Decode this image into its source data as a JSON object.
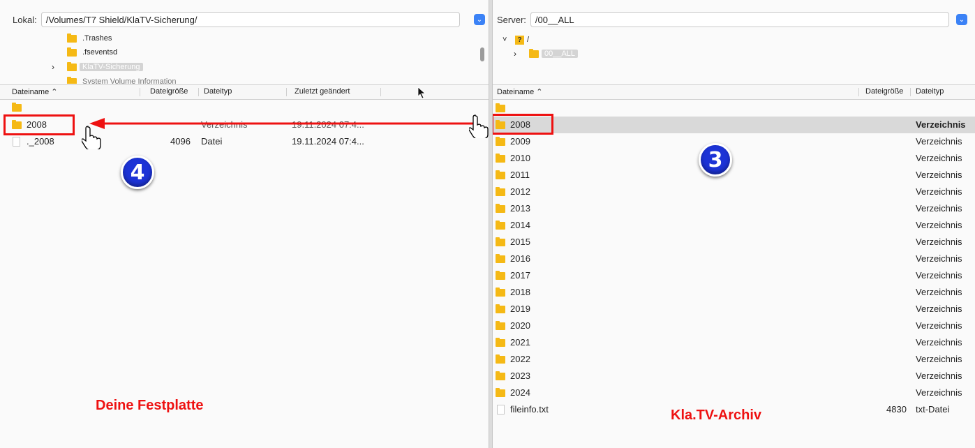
{
  "local": {
    "label": "Lokal:",
    "path": "/Volumes/T7 Shield/KlaTV-Sicherung/",
    "tree": [
      {
        "name": ".Trashes",
        "expander": ""
      },
      {
        "name": ".fseventsd",
        "expander": ""
      },
      {
        "name": "KlaTV-Sicherung",
        "expander": "›",
        "selected": true
      },
      {
        "name": "System Volume Information",
        "expander": ""
      }
    ],
    "columns": {
      "name": "Dateiname",
      "size": "Dateigröße",
      "type": "Dateityp",
      "modified": "Zuletzt geändert"
    },
    "rows": [
      {
        "name": "..",
        "size": "",
        "type": "",
        "modified": "",
        "kind": "folder"
      },
      {
        "name": "2008",
        "size": "",
        "type": "Verzeichnis",
        "modified": "19.11.2024 07:4...",
        "kind": "folder"
      },
      {
        "name": "._2008",
        "size": "4096",
        "type": "Datei",
        "modified": "19.11.2024 07:4...",
        "kind": "file"
      }
    ],
    "caption": "Deine Festplatte",
    "badge": "4"
  },
  "server": {
    "label": "Server:",
    "path": "/00__ALL",
    "tree": [
      {
        "name": "/",
        "expander": "˅",
        "icon": "question-folder"
      },
      {
        "name": "00__ALL",
        "expander": "›",
        "selected": true
      }
    ],
    "columns": {
      "name": "Dateiname",
      "size": "Dateigröße",
      "type": "Dateityp"
    },
    "rows": [
      {
        "name": "..",
        "size": "",
        "type": "",
        "kind": "folder"
      },
      {
        "name": "2008",
        "size": "",
        "type": "Verzeichnis",
        "kind": "folder"
      },
      {
        "name": "2009",
        "size": "",
        "type": "Verzeichnis",
        "kind": "folder"
      },
      {
        "name": "2010",
        "size": "",
        "type": "Verzeichnis",
        "kind": "folder"
      },
      {
        "name": "2011",
        "size": "",
        "type": "Verzeichnis",
        "kind": "folder"
      },
      {
        "name": "2012",
        "size": "",
        "type": "Verzeichnis",
        "kind": "folder"
      },
      {
        "name": "2013",
        "size": "",
        "type": "Verzeichnis",
        "kind": "folder"
      },
      {
        "name": "2014",
        "size": "",
        "type": "Verzeichnis",
        "kind": "folder"
      },
      {
        "name": "2015",
        "size": "",
        "type": "Verzeichnis",
        "kind": "folder"
      },
      {
        "name": "2016",
        "size": "",
        "type": "Verzeichnis",
        "kind": "folder"
      },
      {
        "name": "2017",
        "size": "",
        "type": "Verzeichnis",
        "kind": "folder"
      },
      {
        "name": "2018",
        "size": "",
        "type": "Verzeichnis",
        "kind": "folder"
      },
      {
        "name": "2019",
        "size": "",
        "type": "Verzeichnis",
        "kind": "folder"
      },
      {
        "name": "2020",
        "size": "",
        "type": "Verzeichnis",
        "kind": "folder"
      },
      {
        "name": "2021",
        "size": "",
        "type": "Verzeichnis",
        "kind": "folder"
      },
      {
        "name": "2022",
        "size": "",
        "type": "Verzeichnis",
        "kind": "folder"
      },
      {
        "name": "2023",
        "size": "",
        "type": "Verzeichnis",
        "kind": "folder"
      },
      {
        "name": "2024",
        "size": "",
        "type": "Verzeichnis",
        "kind": "folder"
      },
      {
        "name": "fileinfo.txt",
        "size": "4830",
        "type": "txt-Datei",
        "kind": "file"
      }
    ],
    "caption": "Kla.TV-Archiv",
    "badge": "3"
  },
  "icons": {
    "folder": "folder-icon",
    "file": "file-icon",
    "hand": "pointer-hand-icon",
    "arrow": "cursor-arrow-icon",
    "sort": "sort-ascending-icon"
  },
  "colors": {
    "annotation_red": "#ee1111",
    "badge_blue": "#1c33d6",
    "folder_yellow": "#f5b915",
    "select_blue": "#3b82f6",
    "selected_row": "#d9d9d9"
  }
}
